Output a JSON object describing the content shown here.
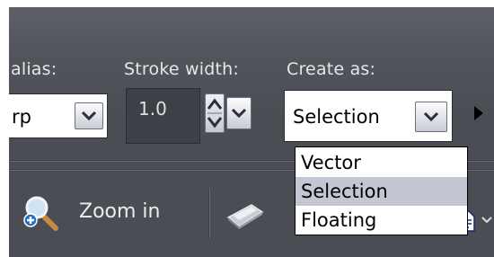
{
  "toolbar": {
    "antialias_label": "alias:",
    "antialias_value": "rp",
    "stroke_width_label": "Stroke width:",
    "stroke_width_value": "1.0",
    "create_as_label": "Create as:",
    "create_as_value": "Selection",
    "create_as_options": [
      "Vector",
      "Selection",
      "Floating"
    ],
    "create_as_highlighted": "Selection"
  },
  "bottom_bar": {
    "zoom_in_label": "Zoom in"
  },
  "icons": [
    "chevron-down-icon",
    "spin-up-icon",
    "spin-down-icon",
    "expand-right-icon",
    "zoom-in-icon",
    "scanner-icon",
    "document-icon"
  ]
}
